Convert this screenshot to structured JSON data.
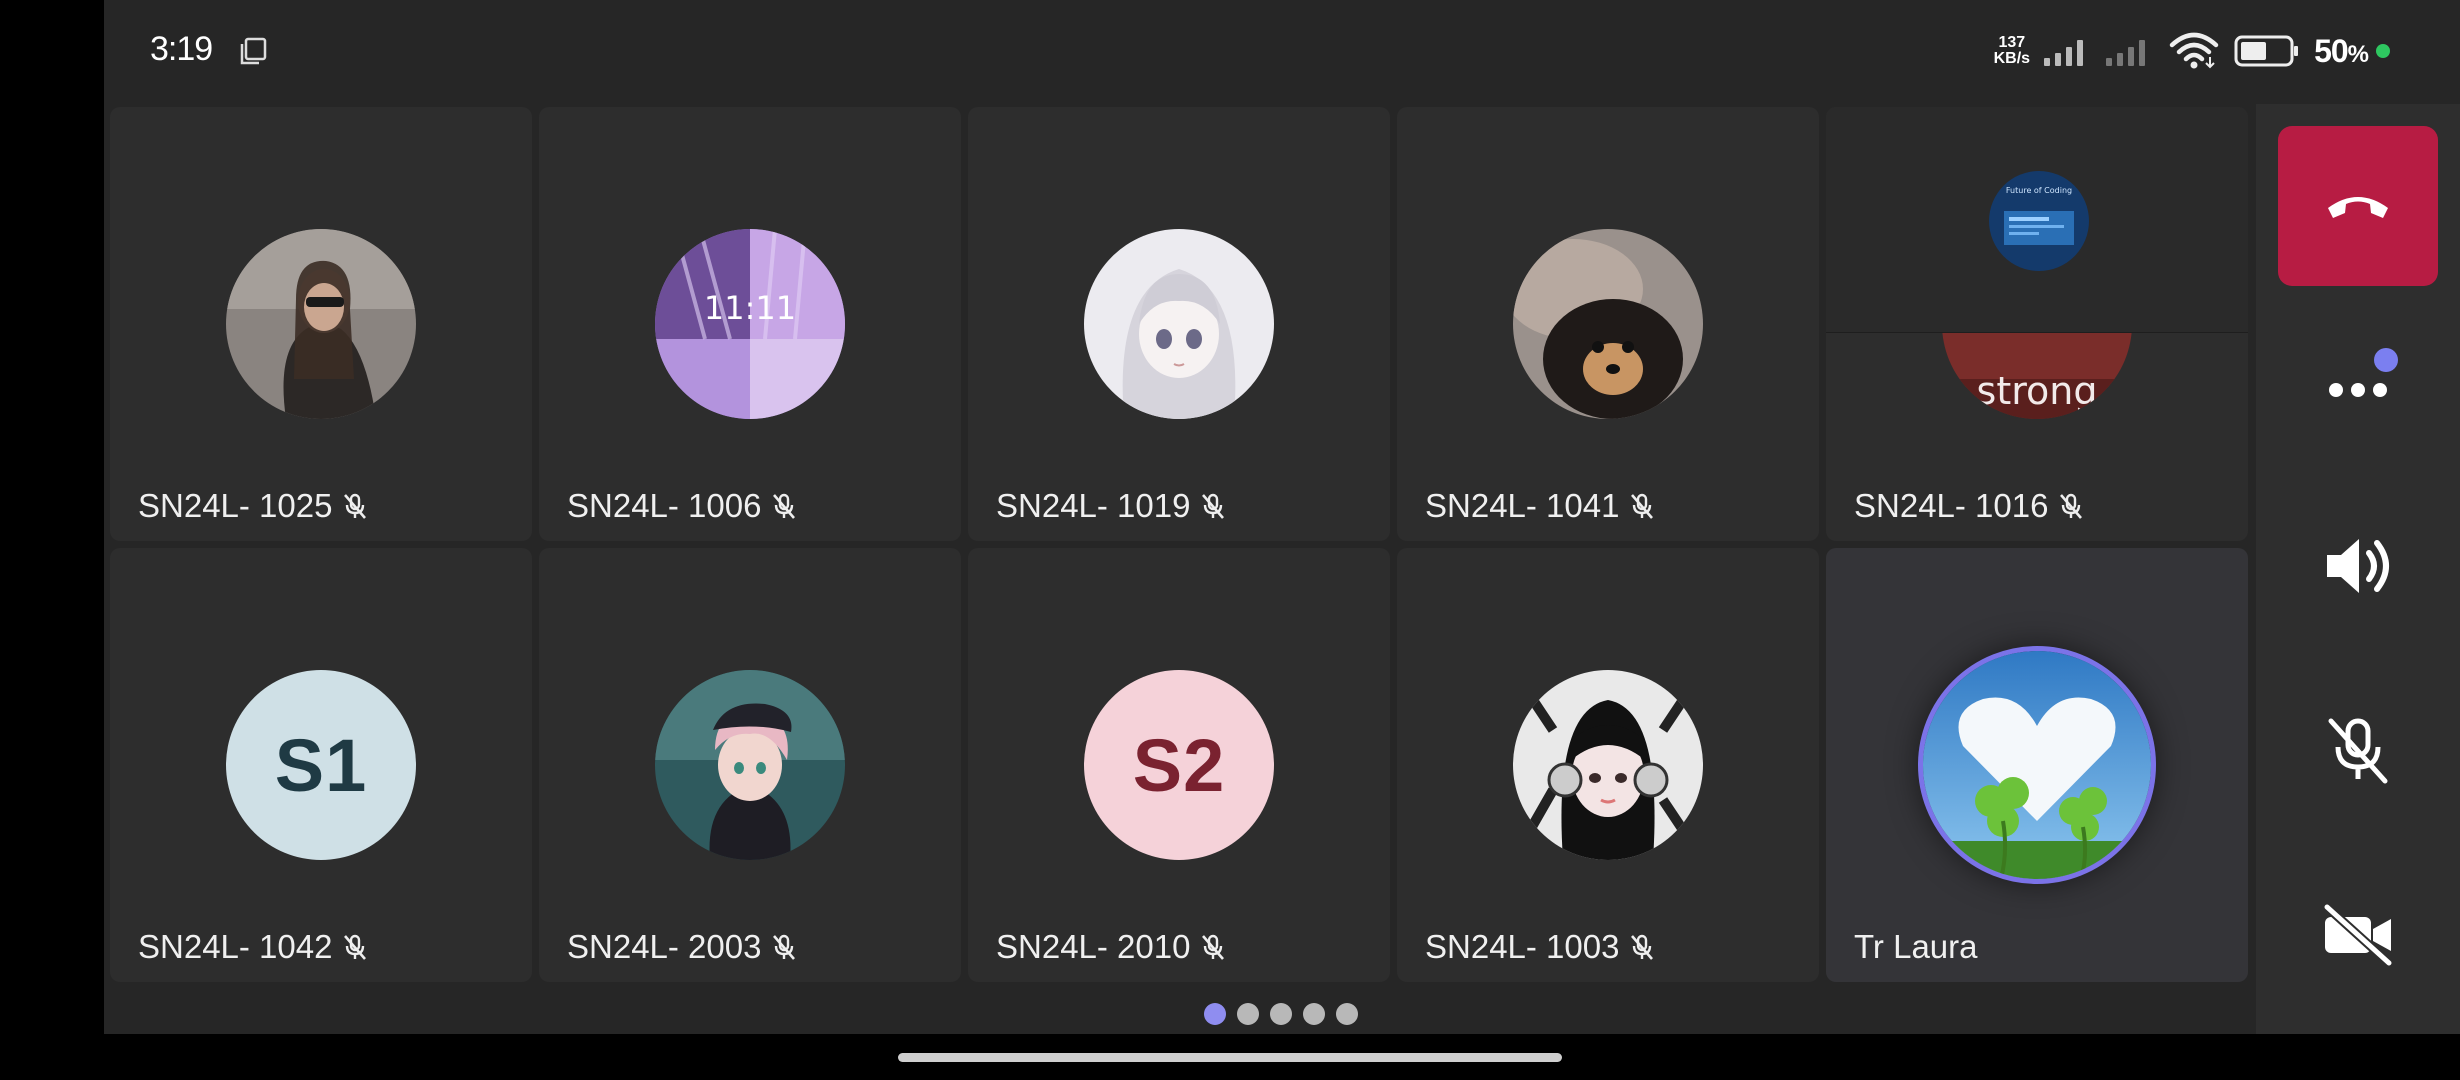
{
  "status_bar": {
    "time": "3:19",
    "net_speed_value": "137",
    "net_speed_unit": "KB/s",
    "battery_percent": "50",
    "battery_suffix": "%"
  },
  "participants": [
    {
      "name": "SN24L- 1025",
      "muted": true,
      "avatar": "photo-woman-sunglasses"
    },
    {
      "name": "SN24L- 1006",
      "muted": true,
      "avatar": "photo-purple-collage",
      "avatar_text": "11:11"
    },
    {
      "name": "SN24L- 1019",
      "muted": true,
      "avatar": "anime-white-hair-girl"
    },
    {
      "name": "SN24L- 1041",
      "muted": true,
      "avatar": "photo-black-dog"
    },
    {
      "name": "SN24L- 1016",
      "muted": true,
      "avatar": "photo-strong-text",
      "avatar_text": "strong",
      "share_preview_text": "Future of Coding"
    },
    {
      "name": "SN24L- 1042",
      "muted": true,
      "initials": "S1",
      "initials_bg": "#cfe0e6",
      "initials_color": "#1f3a44"
    },
    {
      "name": "SN24L- 2003",
      "muted": true,
      "avatar": "anime-cap-girl"
    },
    {
      "name": "SN24L- 2010",
      "muted": true,
      "initials": "S2",
      "initials_bg": "#f5d2d9",
      "initials_color": "#7a2230"
    },
    {
      "name": "SN24L- 1003",
      "muted": true,
      "avatar": "anime-headphones-girl"
    },
    {
      "name": "Tr Laura",
      "muted": false,
      "avatar": "heart-cloud-clover",
      "active_speaker": true
    }
  ],
  "controls": {
    "end_call": "hang-up-icon",
    "more": "more-options-icon",
    "speaker": "speaker-icon",
    "mic": "mic-off-icon",
    "camera": "camera-off-icon"
  },
  "pagination": {
    "pages": 5,
    "current": 1
  },
  "colors": {
    "accent": "#7b73e8",
    "end_call": "#b71c43",
    "tile_bg": "#2d2d2d",
    "page_bg": "#262626"
  }
}
